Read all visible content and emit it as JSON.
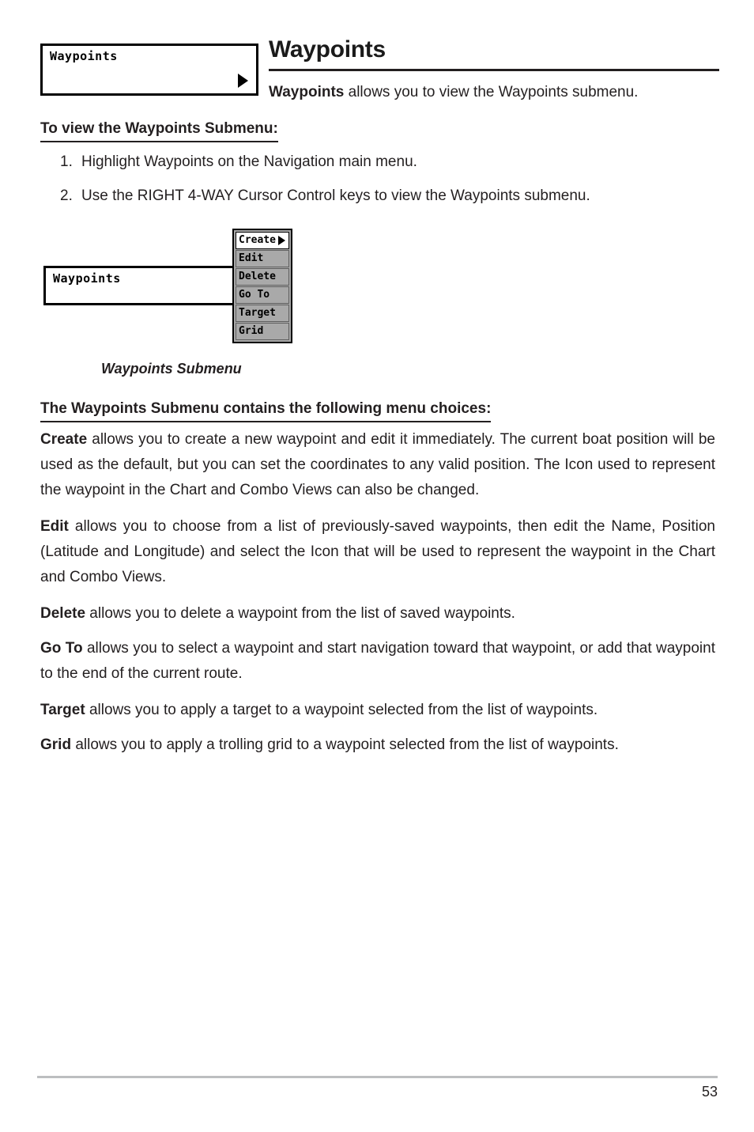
{
  "document": {
    "title": "Waypoints",
    "intro_bold": "Waypoints",
    "intro_rest": " allows you to view the Waypoints submenu."
  },
  "menu_widget_top": {
    "label": "Waypoints",
    "arrow_icon": "triangle-right-icon"
  },
  "steps_section": {
    "heading": "To view the Waypoints Submenu:",
    "steps": [
      {
        "number": "1.",
        "text": "Highlight Waypoints on the Navigation main menu."
      },
      {
        "number": "2.",
        "text": "Use the RIGHT 4-WAY Cursor Control keys to view the Waypoints submenu."
      }
    ]
  },
  "figure": {
    "menu_label": "Waypoints",
    "caption": "Waypoints Submenu",
    "submenu_items": [
      {
        "label": "Create",
        "selected": true,
        "has_arrow": true
      },
      {
        "label": "Edit",
        "selected": false,
        "has_arrow": false
      },
      {
        "label": "Delete",
        "selected": false,
        "has_arrow": false
      },
      {
        "label": "Go To",
        "selected": false,
        "has_arrow": false
      },
      {
        "label": "Target",
        "selected": false,
        "has_arrow": false
      },
      {
        "label": "Grid",
        "selected": false,
        "has_arrow": false
      }
    ],
    "colors": {
      "item_gray": "#a9a9a9",
      "item_selected": "#ffffff",
      "border": "#000000"
    }
  },
  "choices_section": {
    "heading": "The Waypoints Submenu contains the following menu choices:",
    "entries": [
      {
        "term": "Create",
        "text": " allows you to create a new waypoint and edit it immediately.  The current boat position will be used as the default, but you can set the coordinates to any valid position. The Icon used to represent the waypoint in the Chart and Combo Views can also be changed."
      },
      {
        "term": "Edit",
        "text": " allows you to choose from a list of previously-saved waypoints, then edit the Name, Position (Latitude and Longitude) and select the Icon that will be used to represent the waypoint in the Chart and Combo Views."
      },
      {
        "term": "Delete",
        "text": " allows you to delete a waypoint from the list of saved waypoints."
      },
      {
        "term": "Go To",
        "text": " allows you to select a waypoint and start navigation toward that waypoint, or add that waypoint to the end of the current route."
      },
      {
        "term": "Target",
        "text": " allows you to apply a target to a waypoint selected from the list of waypoints."
      },
      {
        "term": "Grid",
        "text": " allows you to apply a trolling grid to a waypoint selected from the list of waypoints."
      }
    ]
  },
  "footer": {
    "page_number": "53",
    "rule_color": "#bcbec0"
  }
}
